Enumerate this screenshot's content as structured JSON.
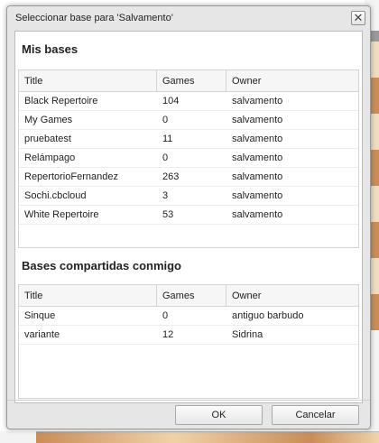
{
  "dialog": {
    "title": "Seleccionar base para 'Salvamento'",
    "close_glyph": "✕"
  },
  "columns": {
    "title": "Title",
    "games": "Games",
    "owner": "Owner"
  },
  "my_bases": {
    "heading": "Mis bases",
    "rows": [
      {
        "title": "Black Repertoire",
        "games": "104",
        "owner": "salvamento"
      },
      {
        "title": "My Games",
        "games": "0",
        "owner": "salvamento"
      },
      {
        "title": "pruebatest",
        "games": "11",
        "owner": "salvamento"
      },
      {
        "title": "Relámpago",
        "games": "0",
        "owner": "salvamento"
      },
      {
        "title": "RepertorioFernandez",
        "games": "263",
        "owner": "salvamento"
      },
      {
        "title": "Sochi.cbcloud",
        "games": "3",
        "owner": "salvamento"
      },
      {
        "title": "White Repertoire",
        "games": "53",
        "owner": "salvamento"
      }
    ]
  },
  "shared_bases": {
    "heading": "Bases compartidas conmigo",
    "rows": [
      {
        "title": "Sinque",
        "games": "0",
        "owner": "antiguo barbudo"
      },
      {
        "title": "variante",
        "games": "12",
        "owner": "Sidrina"
      }
    ]
  },
  "buttons": {
    "ok": "OK",
    "cancel": "Cancelar"
  }
}
